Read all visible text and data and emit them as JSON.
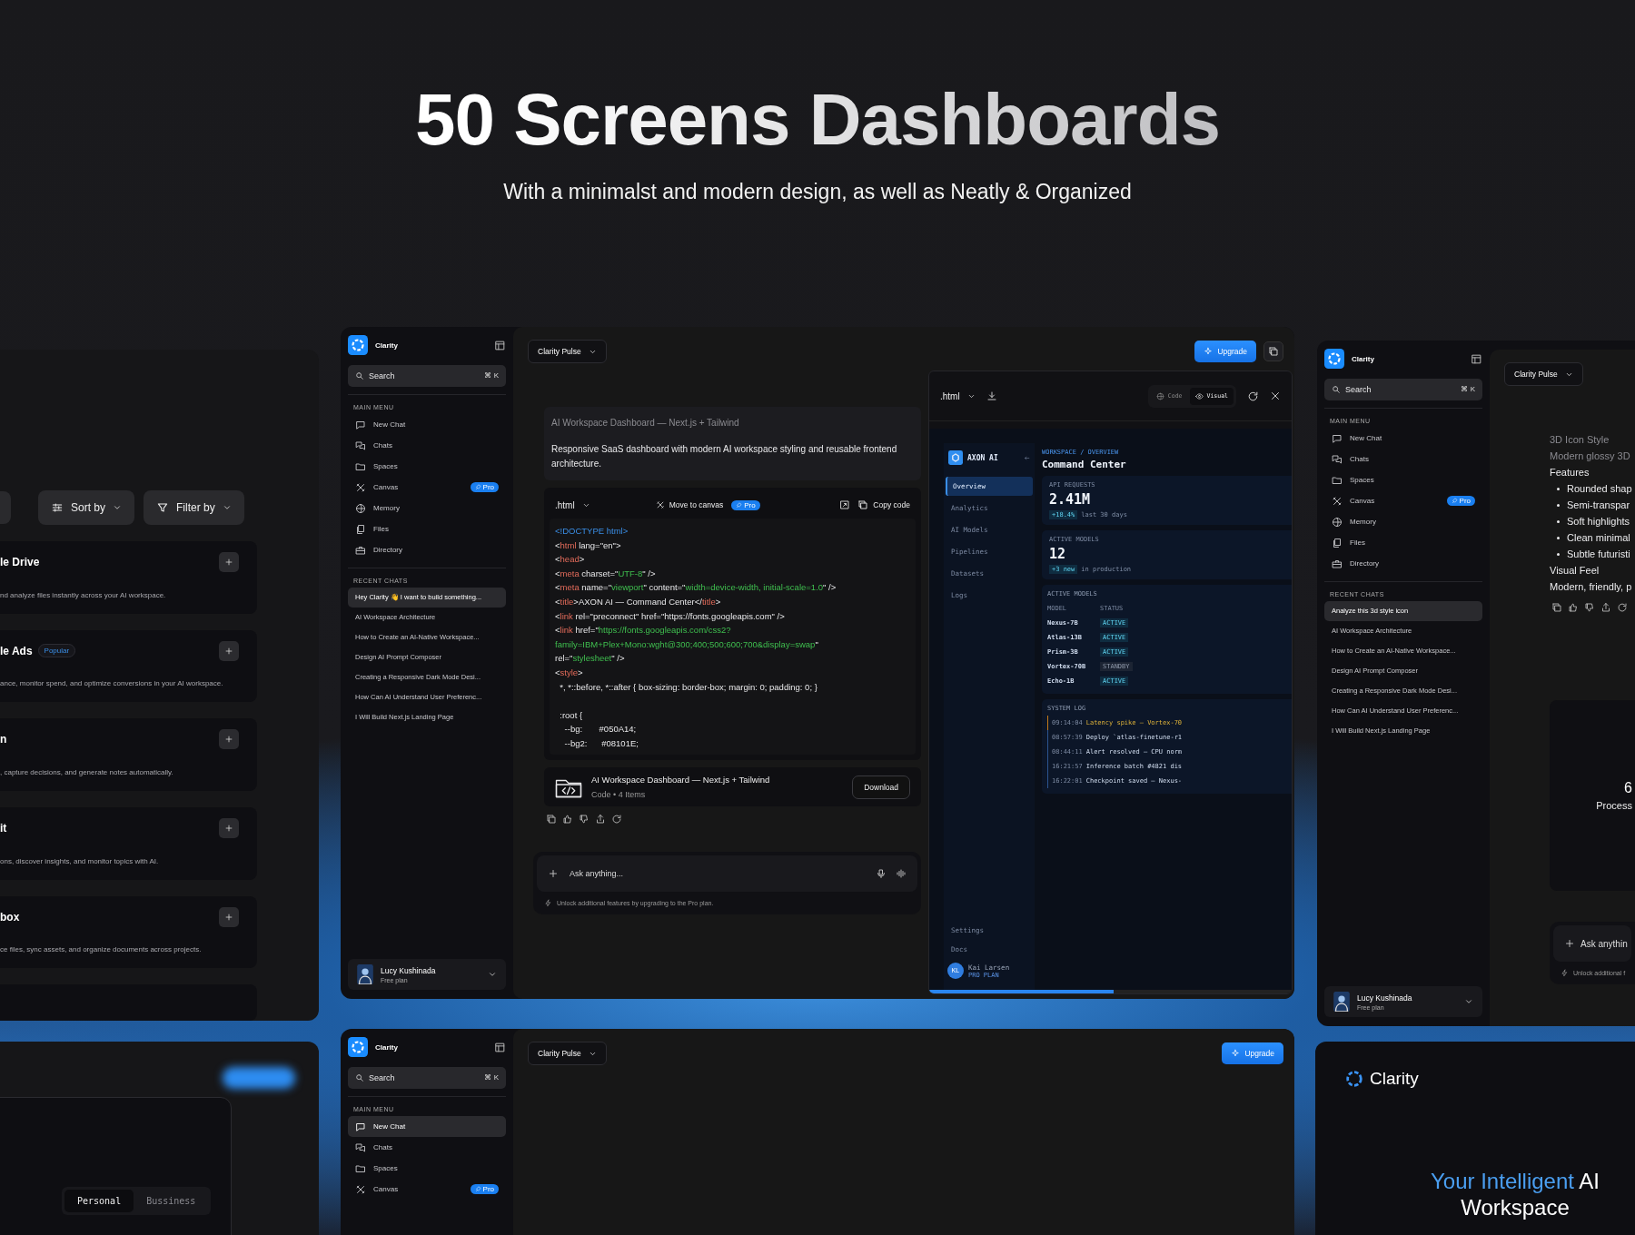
{
  "hero": {
    "title": "50 Screens Dashboards",
    "subtitle": "With a minimalst and modern design, as well as Neatly & Organized"
  },
  "integrations_panel": {
    "sort_label": "Sort by",
    "filter_label": "Filter by",
    "cards": [
      {
        "name": "le Drive",
        "description": "nd analyze files instantly across your AI workspace."
      },
      {
        "name": "le Ads",
        "badge": "Popular",
        "description": "ance, monitor spend, and optimize conversions in your AI workspace."
      },
      {
        "name": "n",
        "description": ", capture decisions, and generate notes automatically."
      },
      {
        "name": "it",
        "description": "ons, discover insights, and monitor topics with AI."
      },
      {
        "name": "box",
        "description": "ce files, sync assets, and organize documents across projects."
      }
    ]
  },
  "plans_panel": {
    "options": [
      {
        "label": "Personal",
        "selected": true
      },
      {
        "label": "Bussiness",
        "selected": false
      }
    ]
  },
  "app_windows": [
    {
      "kind": "code",
      "sidebar": {
        "brand": "Clarity",
        "search": {
          "placeholder": "Search",
          "shortcut": "⌘ K"
        },
        "menu_title": "MAIN MENU",
        "menu": [
          {
            "label": "New Chat",
            "selected": false
          },
          {
            "label": "Chats",
            "selected": false
          },
          {
            "label": "Spaces",
            "selected": false
          },
          {
            "label": "Canvas",
            "selected": false,
            "badge": "Pro"
          },
          {
            "label": "Memory",
            "selected": false
          },
          {
            "label": "Files",
            "selected": false
          },
          {
            "label": "Directory",
            "selected": false
          }
        ],
        "recent_title": "RECENT CHATS",
        "recent": [
          {
            "label": "Hey Clarity 👋 I want to build something...",
            "selected": true
          },
          {
            "label": "AI Workspace Architecture",
            "selected": false
          },
          {
            "label": "How to Create an AI-Native Workspace...",
            "selected": false
          },
          {
            "label": "Design AI Prompt Composer",
            "selected": false
          },
          {
            "label": "Creating a Responsive Dark Mode Desi...",
            "selected": false
          },
          {
            "label": "How Can AI Understand User Preferenc...",
            "selected": false
          },
          {
            "label": "I Will Build Next.js Landing Page",
            "selected": false
          }
        ],
        "user": {
          "name": "Lucy Kushinada",
          "plan": "Free plan"
        }
      },
      "model_picker": "Clarity Pulse",
      "upgrade": "Upgrade",
      "message": {
        "title": "AI Workspace Dashboard — Next.js + Tailwind",
        "body": "Responsive SaaS dashboard with modern AI workspace styling and reusable frontend architecture."
      },
      "code": {
        "language": ".html",
        "move_label": "Move to canvas",
        "badge": "Pro",
        "copy_label": "Copy code",
        "lines": [
          {
            "tokens": [
              {
                "text": "<!DOCTYPE html>",
                "kind": "doctype"
              }
            ]
          },
          {
            "tokens": [
              {
                "text": "<",
                "kind": "plain"
              },
              {
                "text": "html",
                "kind": "tag"
              },
              {
                "text": " lang=\"en\">",
                "kind": "plain"
              }
            ]
          },
          {
            "tokens": [
              {
                "text": "<",
                "kind": "plain"
              },
              {
                "text": "head",
                "kind": "tag"
              },
              {
                "text": ">",
                "kind": "plain"
              }
            ]
          },
          {
            "tokens": [
              {
                "text": "<",
                "kind": "plain"
              },
              {
                "text": "meta",
                "kind": "tag"
              },
              {
                "text": " charset=\"",
                "kind": "plain"
              },
              {
                "text": "UTF-8",
                "kind": "string"
              },
              {
                "text": "\" />",
                "kind": "plain"
              }
            ]
          },
          {
            "tokens": [
              {
                "text": "<",
                "kind": "plain"
              },
              {
                "text": "meta",
                "kind": "tag"
              },
              {
                "text": " name=\"",
                "kind": "plain"
              },
              {
                "text": "viewport",
                "kind": "string"
              },
              {
                "text": "\" content=\"",
                "kind": "plain"
              },
              {
                "text": "width=device-width, initial-scale=1.0",
                "kind": "string"
              },
              {
                "text": "\" />",
                "kind": "plain"
              }
            ]
          },
          {
            "tokens": [
              {
                "text": "<",
                "kind": "plain"
              },
              {
                "text": "title",
                "kind": "tag"
              },
              {
                "text": ">AXON AI — Command Center</",
                "kind": "plain"
              },
              {
                "text": "title",
                "kind": "tag"
              },
              {
                "text": ">",
                "kind": "plain"
              }
            ]
          },
          {
            "tokens": [
              {
                "text": "<",
                "kind": "plain"
              },
              {
                "text": "link",
                "kind": "tag"
              },
              {
                "text": " rel=\"preconnect\" href=\"https://fonts.googleapis.com\" />",
                "kind": "plain"
              }
            ]
          },
          {
            "tokens": [
              {
                "text": "<",
                "kind": "plain"
              },
              {
                "text": "link",
                "kind": "tag"
              },
              {
                "text": " href=\"",
                "kind": "plain"
              },
              {
                "text": "https://fonts.googleapis.com/css2?",
                "kind": "string"
              }
            ]
          },
          {
            "tokens": [
              {
                "text": "family=IBM+Plex+Mono:wght@300;400;500;600;700&display=swap",
                "kind": "string"
              },
              {
                "text": "\"",
                "kind": "plain"
              }
            ]
          },
          {
            "tokens": [
              {
                "text": "rel=\"",
                "kind": "plain"
              },
              {
                "text": "stylesheet",
                "kind": "string"
              },
              {
                "text": "\" />",
                "kind": "plain"
              }
            ]
          },
          {
            "tokens": [
              {
                "text": "<",
                "kind": "plain"
              },
              {
                "text": "style",
                "kind": "tag"
              },
              {
                "text": ">",
                "kind": "plain"
              }
            ]
          },
          {
            "tokens": [
              {
                "text": "  *, *::before, *::after { box-sizing: border-box; margin: 0; padding: 0; }",
                "kind": "plain"
              }
            ]
          },
          {
            "tokens": [
              {
                "text": "  :root {",
                "kind": "plain"
              }
            ],
            "gap_before": true
          },
          {
            "tokens": [
              {
                "text": "    --bg:       #050A14;",
                "kind": "plain"
              }
            ]
          },
          {
            "tokens": [
              {
                "text": "    --bg2:      #08101E;",
                "kind": "plain"
              }
            ]
          }
        ]
      },
      "attachment": {
        "title": "AI Workspace Dashboard — Next.js + Tailwind",
        "meta": "Code • 4 Items",
        "action": "Download"
      },
      "composer": {
        "placeholder": "Ask anything...",
        "note": "Unlock additional features by upgrading to the Pro plan."
      },
      "preview": {
        "language": ".html",
        "tabs": [
          {
            "label": "Code",
            "selected": false
          },
          {
            "label": "Visual",
            "selected": true
          }
        ],
        "app": {
          "brand": "AXON AI",
          "nav": [
            {
              "label": "Overview",
              "selected": true
            },
            {
              "label": "Analytics",
              "selected": false
            },
            {
              "label": "AI Models",
              "selected": false
            },
            {
              "label": "Pipelines",
              "selected": false
            },
            {
              "label": "Datasets",
              "selected": false
            },
            {
              "label": "Logs",
              "selected": false
            }
          ],
          "footer_nav": [
            "Settings",
            "Docs"
          ],
          "user": {
            "initials": "KL",
            "name": "Kai Larsen",
            "plan": "PRO PLAN"
          },
          "breadcrumb": "WORKSPACE / OVERVIEW",
          "title": "Command Center",
          "stats": [
            {
              "label": "API REQUESTS",
              "value": "2.41M",
              "delta": "+18.4%",
              "note": "last 30 days"
            },
            {
              "label": "ACTIVE MODELS",
              "value": "12",
              "delta": "+3 new",
              "note": "in production"
            }
          ],
          "models": {
            "title": "ACTIVE MODELS",
            "columns": [
              "MODEL",
              "STATUS"
            ],
            "rows": [
              {
                "name": "Nexus-7B",
                "status": "ACTIVE",
                "active": true
              },
              {
                "name": "Atlas-13B",
                "status": "ACTIVE",
                "active": true
              },
              {
                "name": "Prism-3B",
                "status": "ACTIVE",
                "active": true
              },
              {
                "name": "Vortex-70B",
                "status": "STANDBY",
                "active": false
              },
              {
                "name": "Echo-1B",
                "status": "ACTIVE",
                "active": true
              }
            ]
          },
          "log": {
            "title": "SYSTEM LOG",
            "entries": [
              {
                "time": "09:14:04",
                "message": "Latency spike — Vortex-70",
                "kind": "warning"
              },
              {
                "time": "08:57:39",
                "message": "Deploy `atlas-finetune-r1",
                "kind": "info"
              },
              {
                "time": "08:44:11",
                "message": "Alert resolved — CPU norm",
                "kind": "info"
              },
              {
                "time": "16:21:57",
                "message": "Inference batch #4821 dis",
                "kind": "info"
              },
              {
                "time": "16:22:01",
                "message": "Checkpoint saved — Nexus-",
                "kind": "info"
              }
            ]
          }
        },
        "progress": {
          "level": 0.51
        }
      }
    },
    {
      "kind": "chat",
      "sidebar": {
        "brand": "Clarity",
        "search": {
          "placeholder": "Search",
          "shortcut": "⌘ K"
        },
        "menu_title": "MAIN MENU",
        "menu": [
          {
            "label": "New Chat",
            "selected": false
          },
          {
            "label": "Chats",
            "selected": false
          },
          {
            "label": "Spaces",
            "selected": false
          },
          {
            "label": "Canvas",
            "selected": false,
            "badge": "Pro"
          },
          {
            "label": "Memory",
            "selected": false
          },
          {
            "label": "Files",
            "selected": false
          },
          {
            "label": "Directory",
            "selected": false
          }
        ],
        "recent_title": "RECENT CHATS",
        "recent": [
          {
            "label": "Analyze this 3d style icon",
            "selected": true
          },
          {
            "label": "AI Workspace Architecture",
            "selected": false
          },
          {
            "label": "How to Create an AI-Native Workspace...",
            "selected": false
          },
          {
            "label": "Design AI Prompt Composer",
            "selected": false
          },
          {
            "label": "Creating a Responsive Dark Mode Desi...",
            "selected": false
          },
          {
            "label": "How Can AI Understand User Preferenc...",
            "selected": false
          },
          {
            "label": "I Will Build Next.js Landing Page",
            "selected": false
          }
        ],
        "user": {
          "name": "Lucy Kushinada",
          "plan": "Free plan"
        }
      },
      "model_picker": "Clarity Pulse",
      "reply": [
        {
          "text": "3D Icon Style",
          "kind": "muted"
        },
        {
          "text": "Modern glossy 3D",
          "kind": "muted"
        },
        {
          "text": "Features",
          "kind": "text"
        },
        {
          "text": "Rounded shap",
          "kind": "bullet"
        },
        {
          "text": "Semi-transpar",
          "kind": "bullet"
        },
        {
          "text": "Soft highlights",
          "kind": "bullet"
        },
        {
          "text": "Clean minimal",
          "kind": "bullet"
        },
        {
          "text": "Subtle futuristi",
          "kind": "bullet"
        },
        {
          "text": "Visual Feel",
          "kind": "text"
        },
        {
          "text": "Modern, friendly, p",
          "kind": "text"
        }
      ],
      "stat_card": {
        "value": "6",
        "label": "Process"
      },
      "composer": {
        "placeholder": "Ask anythin",
        "note": "Unlock additional f"
      }
    },
    {
      "kind": "empty",
      "sidebar": {
        "brand": "Clarity",
        "search": {
          "placeholder": "Search",
          "shortcut": "⌘ K"
        },
        "menu_title": "MAIN MENU",
        "menu": [
          {
            "label": "New Chat",
            "selected": true
          },
          {
            "label": "Chats",
            "selected": false
          },
          {
            "label": "Spaces",
            "selected": false
          },
          {
            "label": "Canvas",
            "selected": false,
            "badge": "Pro"
          }
        ]
      },
      "model_picker": "Clarity Pulse",
      "upgrade": "Upgrade"
    }
  ],
  "brand_card": {
    "brand": "Clarity",
    "headline": [
      {
        "text": "Your Intelligent",
        "accent": true
      },
      {
        "text": " AI Workspace",
        "accent": false
      }
    ]
  }
}
